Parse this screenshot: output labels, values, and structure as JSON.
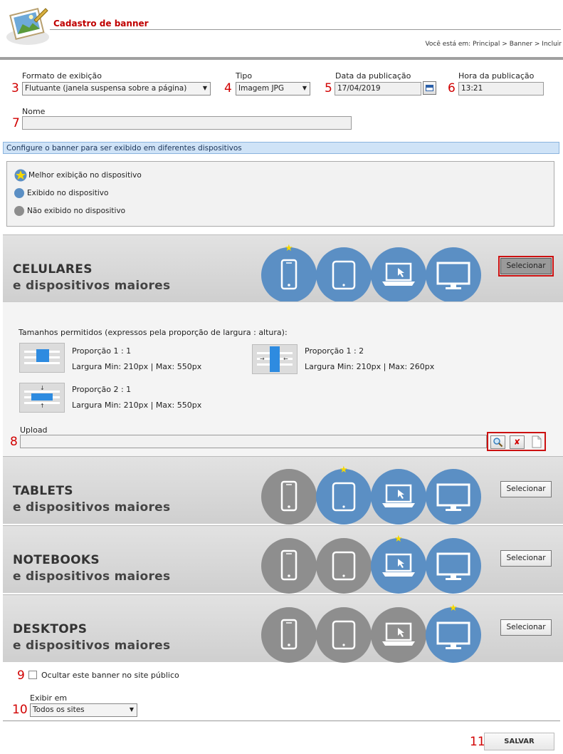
{
  "header": {
    "title": "Cadastro de banner",
    "breadcrumb": "Você está em: Principal > Banner > Incluir"
  },
  "markers": [
    "3",
    "4",
    "5",
    "6",
    "7",
    "8",
    "9",
    "10",
    "11"
  ],
  "form": {
    "formato": {
      "label": "Formato de exibição",
      "value": "Flutuante (janela suspensa sobre a página)"
    },
    "tipo": {
      "label": "Tipo",
      "value": "Imagem JPG"
    },
    "data": {
      "label": "Data da publicação",
      "value": "17/04/2019"
    },
    "hora": {
      "label": "Hora da publicação",
      "value": "13:21"
    },
    "nome": {
      "label": "Nome",
      "value": ""
    }
  },
  "section_bar": "Configure o banner para ser exibido em diferentes dispositivos",
  "legend": [
    {
      "label": "Melhor exibição no dispositivo",
      "kind": "star"
    },
    {
      "label": "Exibido no dispositivo",
      "kind": "blue"
    },
    {
      "label": "Não exibido no dispositivo",
      "kind": "gray"
    }
  ],
  "panels": [
    {
      "title": "CELULARES",
      "subtitle": "e dispositivos maiores",
      "button": "Selecionar",
      "selected": true,
      "devices": [
        "blue",
        "blue",
        "blue",
        "blue"
      ],
      "star_index": 0
    },
    {
      "title": "TABLETS",
      "subtitle": "e dispositivos maiores",
      "button": "Selecionar",
      "selected": false,
      "devices": [
        "gray",
        "blue",
        "blue",
        "blue"
      ],
      "star_index": 1
    },
    {
      "title": "NOTEBOOKS",
      "subtitle": "e dispositivos maiores",
      "button": "Selecionar",
      "selected": false,
      "devices": [
        "gray",
        "gray",
        "blue",
        "blue"
      ],
      "star_index": 2
    },
    {
      "title": "DESKTOPS",
      "subtitle": "e dispositivos maiores",
      "button": "Selecionar",
      "selected": false,
      "devices": [
        "gray",
        "gray",
        "gray",
        "blue"
      ],
      "star_index": 3
    }
  ],
  "expanded": {
    "sizes_heading": "Tamanhos permitidos (expressos pela proporção de largura : altura):",
    "proportions": [
      {
        "name": "Proporção 1 : 1",
        "size": "Largura Min: 210px | Max: 550px"
      },
      {
        "name": "Proporção 1 : 2",
        "size": "Largura Min: 210px | Max: 260px"
      },
      {
        "name": "Proporção 2 : 1",
        "size": "Largura Min: 210px | Max: 550px"
      }
    ],
    "upload_label": "Upload"
  },
  "hide_checkbox_label": "Ocultar este banner no site público",
  "exibir": {
    "label": "Exibir em",
    "value": "Todos os sites"
  },
  "save_label": "SALVAR",
  "colors": {
    "device_on": "#5b8fc4",
    "device_off": "#8e8e8e",
    "star": "#f5d800",
    "marker": "#d10000",
    "title": "#c00000"
  }
}
